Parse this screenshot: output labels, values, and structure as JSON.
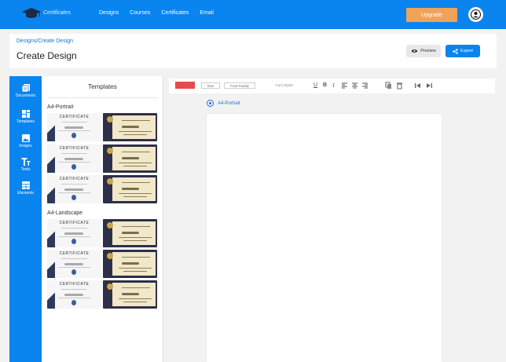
{
  "app": {
    "logo_text": "Certificates"
  },
  "nav": {
    "items": [
      "Designs",
      "Courses",
      "Certificates",
      "Email"
    ]
  },
  "header": {
    "upgrade_label": "Upgrade"
  },
  "page": {
    "breadcrumb": "Designs/Create Design",
    "title": "Create Design",
    "preview_label": "Preview",
    "export_label": "Export"
  },
  "sidebar": {
    "items": [
      {
        "label": "Documents",
        "icon": "documents-icon"
      },
      {
        "label": "Templates",
        "icon": "templates-icon"
      },
      {
        "label": "Images",
        "icon": "image-icon"
      },
      {
        "label": "Texts",
        "icon": "text-icon"
      },
      {
        "label": "Elements",
        "icon": "elements-icon"
      }
    ]
  },
  "templates": {
    "title": "Templates",
    "sections": [
      {
        "label": "A4-Portrait"
      },
      {
        "label": "A4-Landscape"
      }
    ],
    "thumb_title": "CERTIFICATE"
  },
  "editor": {
    "colors": {
      "swatch": "#e64b4b",
      "accent": "#0a84ee"
    },
    "size_placeholder": "Size",
    "font_family_placeholder": "Font Family",
    "font_styles_label": "Font Styles",
    "format_icons": [
      "underline-icon",
      "bold-icon",
      "italic-icon",
      "align-left-icon",
      "align-center-icon",
      "align-right-icon",
      "copy-icon",
      "delete-icon",
      "skip-back-icon",
      "skip-forward-icon"
    ],
    "orientation_label": "A4-Portrait"
  }
}
